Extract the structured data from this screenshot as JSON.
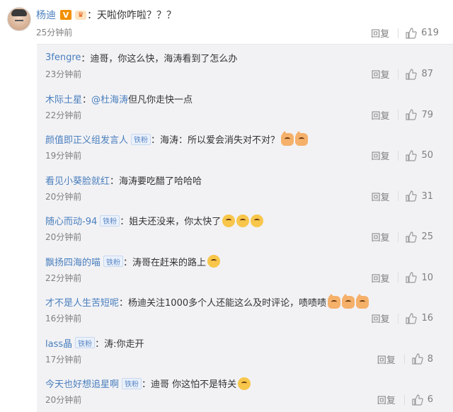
{
  "main_comment": {
    "username": "杨迪",
    "badge": "V",
    "fan_icon": "crown-icon",
    "separator": "：",
    "text": "天啦你咋啦？？？",
    "time": "25分钟前",
    "reply_label": "回复",
    "likes": "619"
  },
  "replies": [
    {
      "username": "3fengre",
      "fan_badge": "",
      "text": "迪哥，你这么快，海涛看到了怎么办",
      "emoji": [],
      "time": "23分钟前",
      "reply_label": "回复",
      "likes": "87"
    },
    {
      "username": "木际土星",
      "fan_badge": "",
      "mention": "@杜海涛",
      "text": " 但凡你走快一点",
      "emoji": [],
      "time": "22分钟前",
      "reply_label": "回复",
      "likes": "79"
    },
    {
      "username": "颜值即正义组发言人",
      "fan_badge": "铁粉",
      "text": "海涛：所以爱会消失对不对？",
      "emoji": [
        "cat",
        "cat"
      ],
      "time": "19分钟前",
      "reply_label": "回复",
      "likes": "50"
    },
    {
      "username": "看见小葵脸就红",
      "fan_badge": "",
      "text": "海涛要吃醋了哈哈哈",
      "emoji": [],
      "time": "20分钟前",
      "reply_label": "回复",
      "likes": "31"
    },
    {
      "username": "随心而动-94",
      "fan_badge": "铁粉",
      "text": "姐夫还没来，你太快了",
      "emoji": [
        "laugh",
        "laugh",
        "laugh"
      ],
      "time": "20分钟前",
      "reply_label": "回复",
      "likes": "25"
    },
    {
      "username": "飘扬四海的喵",
      "fan_badge": "铁粉",
      "text": "涛哥在赶来的路上",
      "emoji": [
        "laugh"
      ],
      "time": "22分钟前",
      "reply_label": "回复",
      "likes": "10"
    },
    {
      "username": "才不是人生苦短呢",
      "fan_badge": "",
      "text": "杨迪关注1000多个人还能这么及时评论，啧啧啧",
      "emoji": [
        "cat",
        "cat",
        "cat"
      ],
      "time": "16分钟前",
      "reply_label": "回复",
      "likes": "16"
    },
    {
      "username": "lass晶",
      "fan_badge": "铁粉",
      "text": "涛:你走开",
      "emoji": [],
      "time": "17分钟前",
      "reply_label": "回复",
      "likes": "8"
    },
    {
      "username": "今天也好想追星啊",
      "fan_badge": "铁粉",
      "text": "迪哥 你这怕不是特关",
      "emoji": [
        "grin"
      ],
      "time": "20分钟前",
      "reply_label": "回复",
      "likes": "6"
    }
  ],
  "colors": {
    "link": "#4a7fbd",
    "meta": "#808080",
    "panel": "#f2f2f5",
    "vip": "#f29000"
  }
}
